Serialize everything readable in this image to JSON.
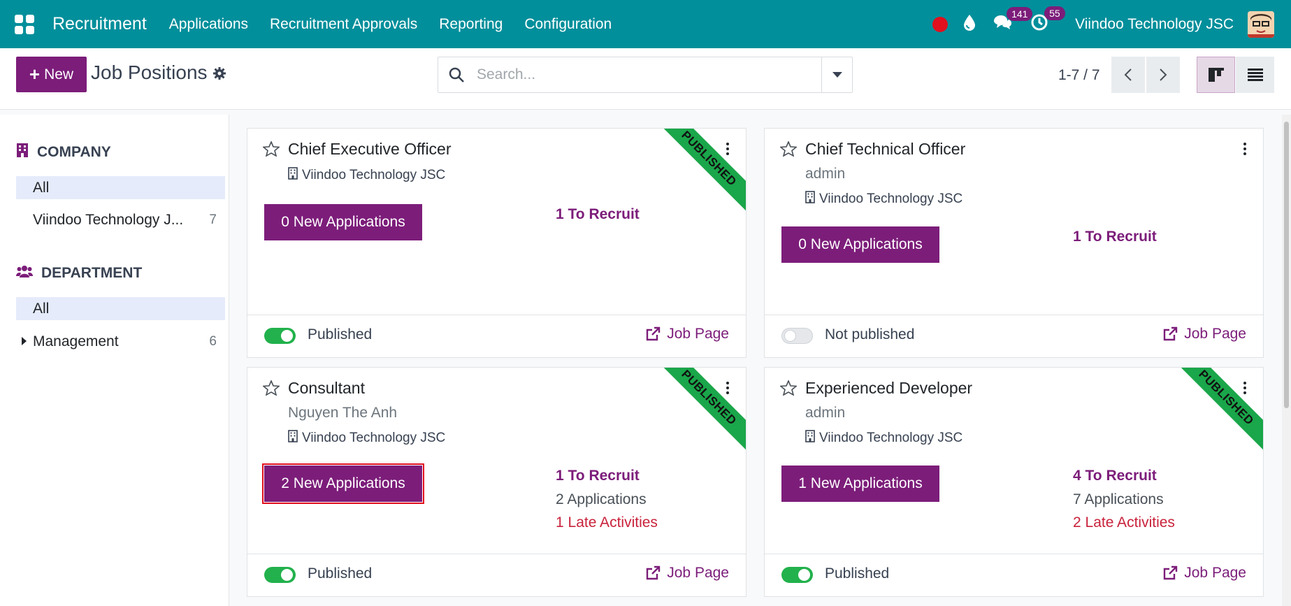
{
  "navbar": {
    "brand": "Recruitment",
    "menu": [
      "Applications",
      "Recruitment Approvals",
      "Reporting",
      "Configuration"
    ],
    "messages_count": "141",
    "activities_count": "55",
    "company": "Viindoo Technology JSC"
  },
  "control": {
    "new_label": "New",
    "page_title": "Job Positions",
    "search_placeholder": "Search...",
    "pager": "1-7 / 7"
  },
  "sidebar": {
    "company_heading": "COMPANY",
    "company_items": [
      {
        "label": "All",
        "count": ""
      },
      {
        "label": "Viindoo Technology J...",
        "count": "7"
      }
    ],
    "department_heading": "DEPARTMENT",
    "department_items": [
      {
        "label": "All",
        "count": ""
      },
      {
        "label": "Management",
        "count": "6"
      }
    ]
  },
  "cards": [
    {
      "title": "Chief Executive Officer",
      "owner": "",
      "company": "Viindoo Technology JSC",
      "new_apps": "0 New Applications",
      "to_recruit": "1 To Recruit",
      "applications": "",
      "late": "",
      "published": true,
      "status": "Published",
      "job_page": "Job Page",
      "ribbon": "PUBLISHED"
    },
    {
      "title": "Chief Technical Officer",
      "owner": "admin",
      "company": "Viindoo Technology JSC",
      "new_apps": "0 New Applications",
      "to_recruit": "1 To Recruit",
      "applications": "",
      "late": "",
      "published": false,
      "status": "Not published",
      "job_page": "Job Page",
      "ribbon": ""
    },
    {
      "title": "Consultant",
      "owner": "Nguyen The Anh",
      "company": "Viindoo Technology JSC",
      "new_apps": "2 New Applications",
      "to_recruit": "1 To Recruit",
      "applications": "2 Applications",
      "late": "1 Late Activities",
      "published": true,
      "status": "Published",
      "job_page": "Job Page",
      "ribbon": "PUBLISHED"
    },
    {
      "title": "Experienced Developer",
      "owner": "admin",
      "company": "Viindoo Technology JSC",
      "new_apps": "1 New Applications",
      "to_recruit": "4 To Recruit",
      "applications": "7 Applications",
      "late": "2 Late Activities",
      "published": true,
      "status": "Published",
      "job_page": "Job Page",
      "ribbon": "PUBLISHED"
    }
  ],
  "colors": {
    "navbar": "#018f9b",
    "primary": "#7c1d7a",
    "published_toggle": "#22b14c",
    "ribbon": "#1aa64a",
    "late": "#c9223b"
  }
}
